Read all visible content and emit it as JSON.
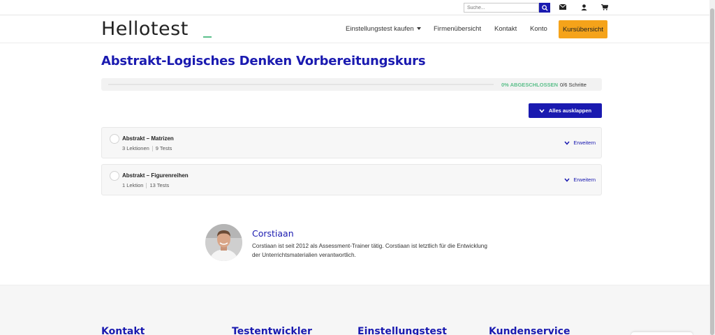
{
  "topbar": {
    "search_placeholder": "Suche...",
    "icons": [
      "search-icon",
      "mail-icon",
      "user-icon",
      "cart-icon"
    ]
  },
  "header": {
    "logo": "Hellotest",
    "nav": {
      "buy": "Einstellungstest kaufen",
      "companies": "Firmenübersicht",
      "contact": "Kontakt",
      "account": "Konto",
      "courses": "Kursübersicht"
    }
  },
  "course": {
    "title": "Abstrakt-Logisches Denken Vorbereitungskurs",
    "progress_percent": 0,
    "progress_label": "0% ABGESCHLOSSEN",
    "steps": "0/6 Schritte",
    "expand_all": "Alles ausklappen",
    "sections": [
      {
        "title": "Abstrakt – Matrizen",
        "lessons": "3 Lektionen",
        "tests": "9 Tests",
        "expand": "Erweitern"
      },
      {
        "title": "Abstrakt – Figurenreihen",
        "lessons": "1 Lektion",
        "tests": "13 Tests",
        "expand": "Erweitern"
      }
    ]
  },
  "author": {
    "name": "Corstiaan",
    "bio": "Corstiaan ist seit 2012 als Assessment-Trainer tätig. Corstiaan ist letztlich für die Entwicklung der Unterrichtsmaterialien verantwortlich."
  },
  "footer": {
    "headings": [
      "Kontakt",
      "Testentwickler",
      "Einstellungstest",
      "Kundenservice"
    ]
  },
  "colors": {
    "brand": "#1a1ab0",
    "accent": "#f5a31a",
    "success": "#5bbf8a"
  }
}
